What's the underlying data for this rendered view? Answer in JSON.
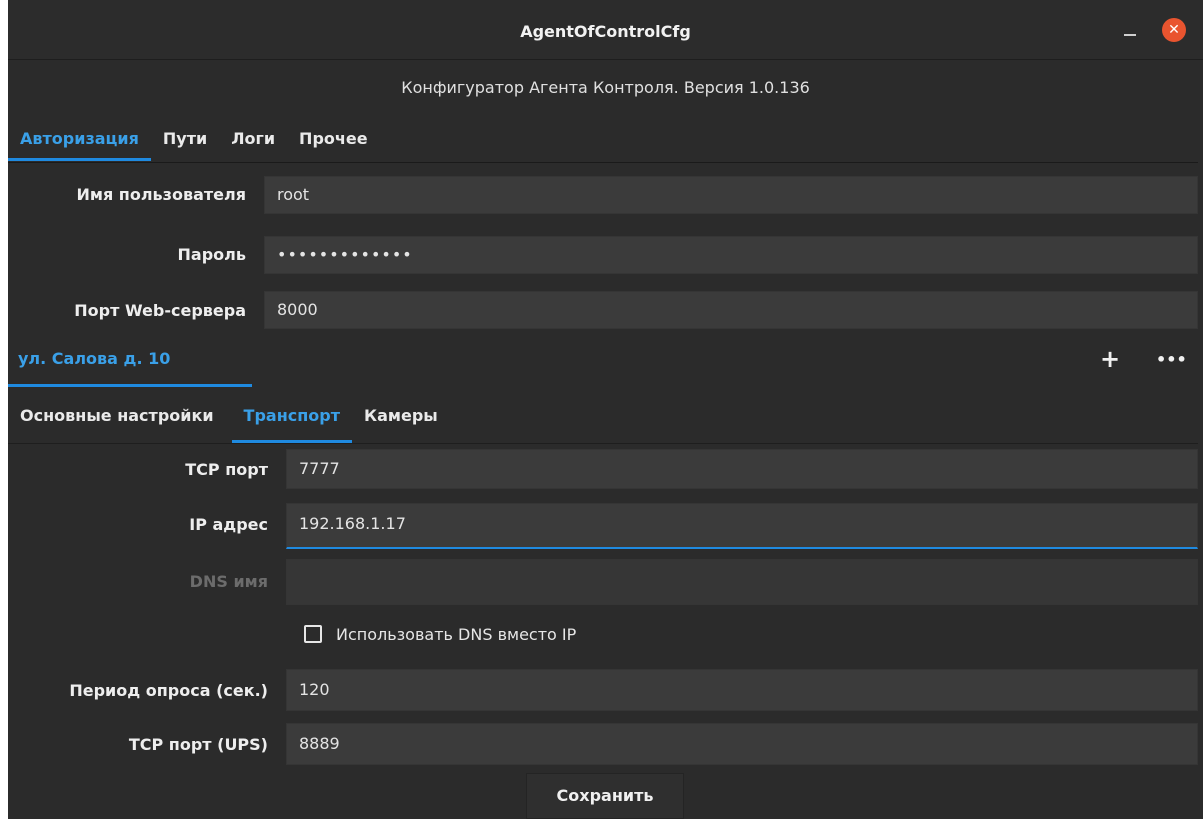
{
  "window": {
    "title": "AgentOfControlCfg",
    "close_glyph": "✕",
    "minimize_glyph": ""
  },
  "header": {
    "subtitle": "Конфигуратор Агента Контроля. Версия 1.0.136"
  },
  "main_tabs": [
    {
      "label": "Авторизация",
      "active": true
    },
    {
      "label": "Пути",
      "active": false
    },
    {
      "label": "Логи",
      "active": false
    },
    {
      "label": "Прочее",
      "active": false
    }
  ],
  "auth": {
    "username_label": "Имя пользователя",
    "username_value": "root",
    "password_label": "Пароль",
    "password_value": "•••••••••••••",
    "web_port_label": "Порт Web-сервера",
    "web_port_value": "8000"
  },
  "location": {
    "name": "ул. Салова д. 10",
    "add_glyph": "+",
    "more_glyph": "•••"
  },
  "sub_tabs": [
    {
      "label": "Основные настройки",
      "active": false
    },
    {
      "label": "Транспорт",
      "active": true
    },
    {
      "label": "Камеры",
      "active": false
    }
  ],
  "transport": {
    "tcp_port_label": "TCP порт",
    "tcp_port_value": "7777",
    "ip_label": "IP адрес",
    "ip_value": "192.168.1.17",
    "dns_label": "DNS имя",
    "dns_value": "",
    "use_dns_label": "Использовать DNS вместо IP",
    "use_dns_checked": false,
    "poll_label": "Период опроса (сек.)",
    "poll_value": "120",
    "ups_port_label": "TCP порт (UPS)",
    "ups_port_value": "8889"
  },
  "footer": {
    "save_label": "Сохранить"
  },
  "colors": {
    "accent": "#1f8ae0",
    "background": "#2b2b2b",
    "field": "#3b3b3b",
    "close": "#e9542f"
  }
}
